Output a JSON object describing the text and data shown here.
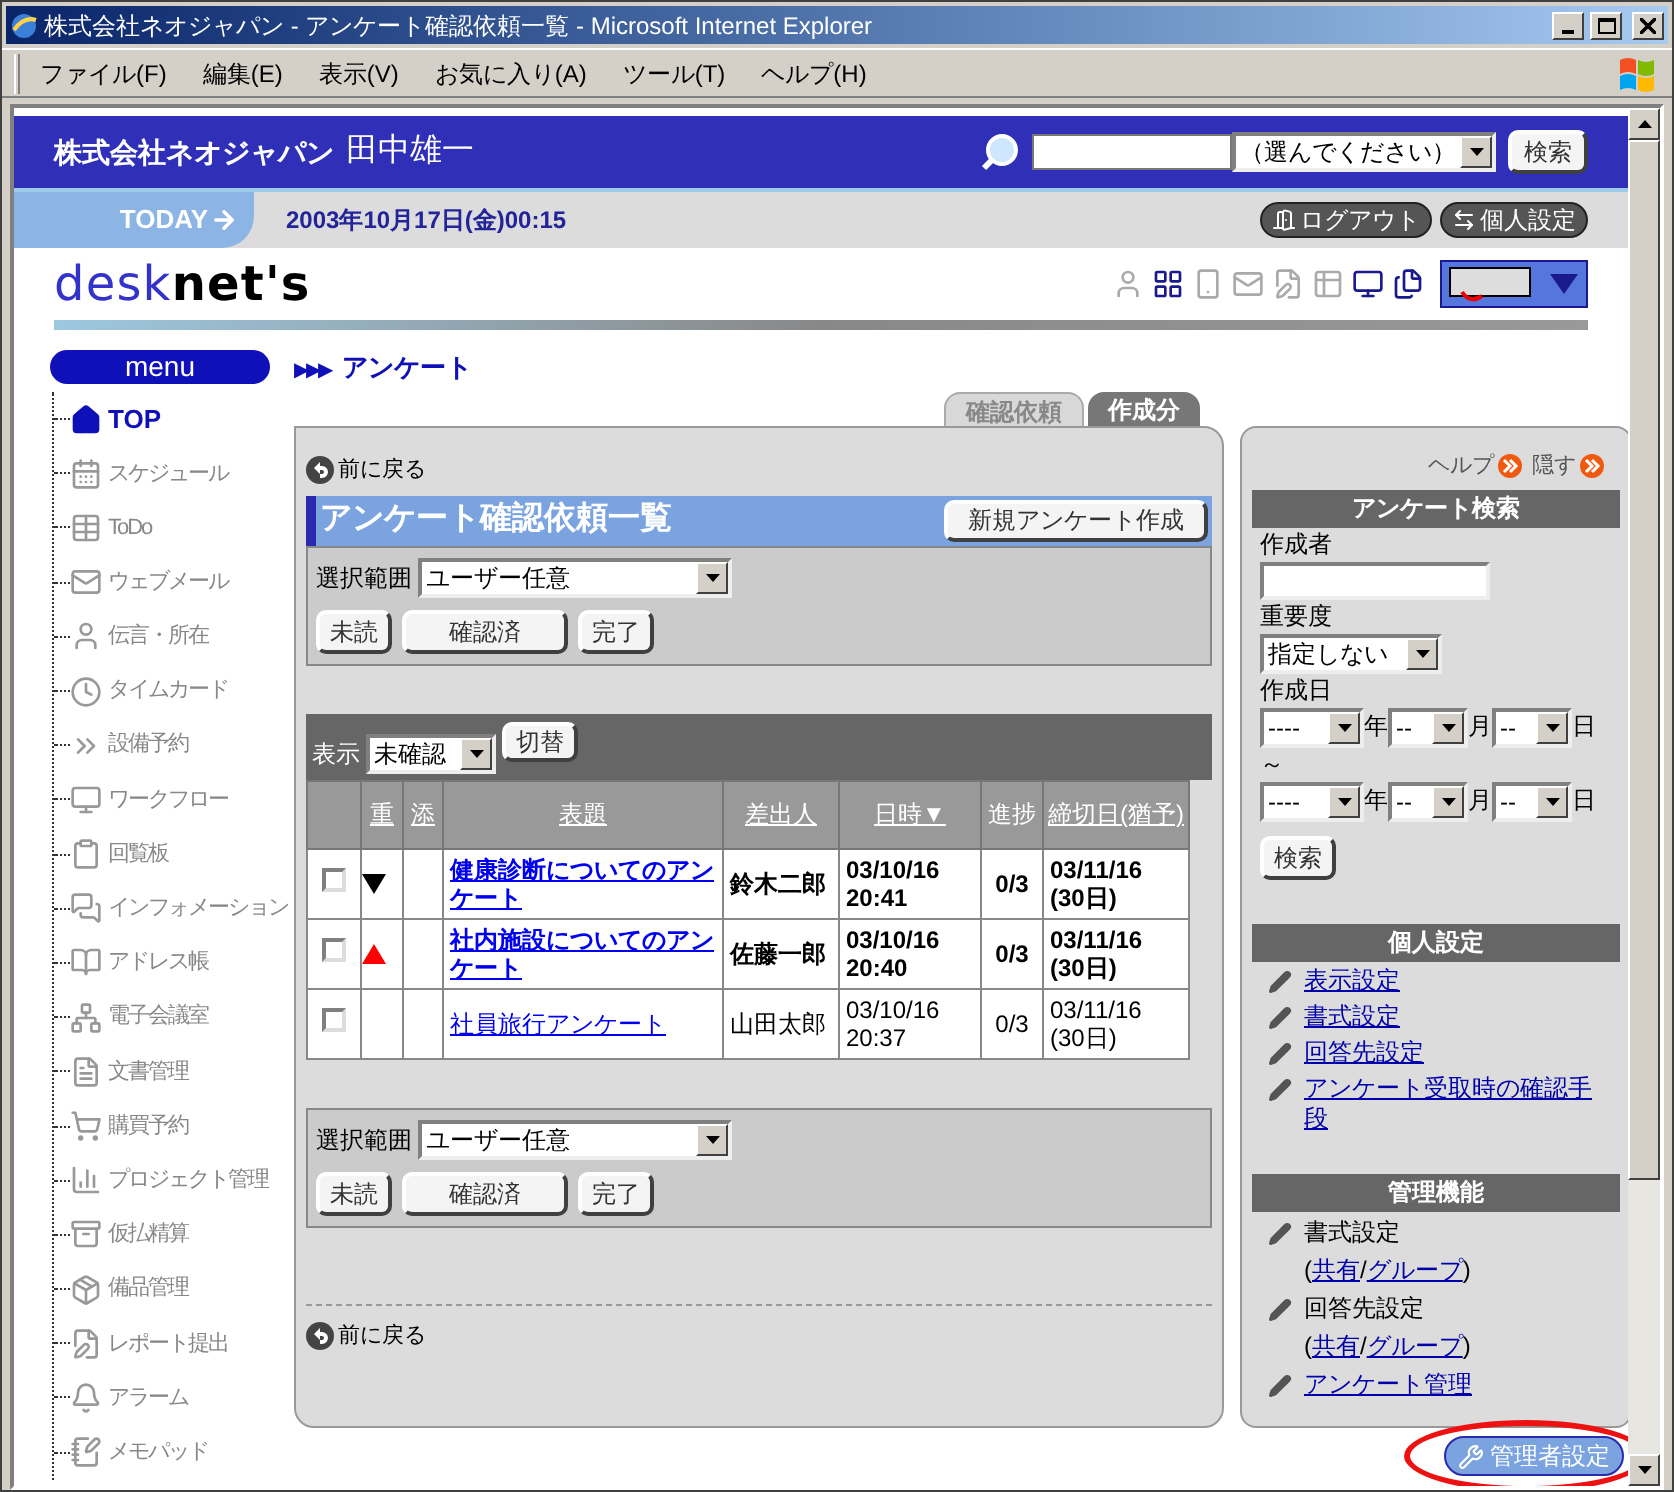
{
  "window": {
    "title": "株式会社ネオジャパン - アンケート確認依頼一覧 - Microsoft Internet Explorer"
  },
  "menu_bar": [
    "ファイル(F)",
    "編集(E)",
    "表示(V)",
    "お気に入り(A)",
    "ツール(T)",
    "ヘルプ(H)"
  ],
  "header": {
    "company": "株式会社ネオジャパン",
    "user": "田中雄一",
    "search_select": "（選んでください）",
    "search_button": "検索"
  },
  "today_bar": {
    "label": "TODAY",
    "date": "2003年10月17日(金)00:15",
    "logout": "ログアウト",
    "personal": "個人設定"
  },
  "logo": "desk**net's**",
  "breadcrumb": {
    "menu": "menu",
    "marker": "▶▶▶",
    "title": "アンケート"
  },
  "sidebar": {
    "items": [
      {
        "label": "TOP",
        "kind": "home"
      },
      {
        "label": "スケジュール",
        "kind": "module"
      },
      {
        "label": "ToDo",
        "kind": "module"
      },
      {
        "label": "ウェブメール",
        "kind": "module"
      },
      {
        "label": "伝言・所在",
        "kind": "module"
      },
      {
        "label": "タイムカード",
        "kind": "module"
      },
      {
        "label": "設備予約",
        "kind": "module"
      },
      {
        "label": "ワークフロー",
        "kind": "module"
      },
      {
        "label": "回覧板",
        "kind": "module"
      },
      {
        "label": "インフォメーション",
        "kind": "module"
      },
      {
        "label": "アドレス帳",
        "kind": "module"
      },
      {
        "label": "電子会議室",
        "kind": "module"
      },
      {
        "label": "文書管理",
        "kind": "module"
      },
      {
        "label": "購買予約",
        "kind": "module"
      },
      {
        "label": "プロジェクト管理",
        "kind": "module"
      },
      {
        "label": "仮払精算",
        "kind": "module"
      },
      {
        "label": "備品管理",
        "kind": "module"
      },
      {
        "label": "レポート提出",
        "kind": "module"
      },
      {
        "label": "アラーム",
        "kind": "module"
      },
      {
        "label": "メモパッド",
        "kind": "module"
      }
    ]
  },
  "tabs": [
    {
      "label": "確認依頼",
      "selected": true
    },
    {
      "label": "作成分",
      "selected": false
    }
  ],
  "main": {
    "back_link": "前に戻る",
    "title": "アンケート確認依頼一覧",
    "new_button": "新規アンケート作成",
    "top_actions": {
      "scope_label": "選択範囲",
      "scope_value": "ユーザー任意",
      "buttons": [
        "未読",
        "確認済",
        "完了"
      ]
    },
    "filter": {
      "label": "表示",
      "value": "未確認",
      "button": "切替"
    },
    "table": {
      "columns": [
        {
          "label": "重",
          "sortable": true
        },
        {
          "label": "添",
          "sortable": true
        },
        {
          "label": "表題",
          "sortable": true
        },
        {
          "label": "差出人",
          "sortable": true
        },
        {
          "label": "日時▼",
          "sortable": true
        },
        {
          "label": "進捗",
          "sortable": false
        },
        {
          "label": "締切日(猶予)",
          "sortable": true
        }
      ],
      "rows": [
        {
          "checked": false,
          "kind": "low",
          "unread": true,
          "title": "健康診断についてのアンケート",
          "sender": "鈴木二郎",
          "datetime": "03/10/16 20:41",
          "progress": "0/3",
          "deadline": "03/11/16 (30日)"
        },
        {
          "checked": false,
          "kind": "high",
          "unread": true,
          "title": "社内施設についてのアンケート",
          "sender": "佐藤一郎",
          "datetime": "03/10/16 20:40",
          "progress": "0/3",
          "deadline": "03/11/16 (30日)"
        },
        {
          "checked": false,
          "kind": "normal",
          "unread": false,
          "title": "社員旅行アンケート",
          "sender": "山田太郎",
          "datetime": "03/10/16 20:37",
          "progress": "0/3",
          "deadline": "03/11/16 (30日)"
        }
      ]
    },
    "bottom_actions": {
      "scope_label": "選択範囲",
      "scope_value": "ユーザー任意",
      "buttons": [
        "未読",
        "確認済",
        "完了"
      ]
    },
    "back_link_bottom": "前に戻る"
  },
  "side_panel": {
    "help": "ヘルプ",
    "hide": "隠す",
    "search": {
      "title": "アンケート検索",
      "author_label": "作成者",
      "importance_label": "重要度",
      "importance_value": "指定しない",
      "date_label": "作成日",
      "dates": [
        {
          "year": "----",
          "year_unit": "年",
          "month": "--",
          "month_unit": "月",
          "day": "--",
          "day_unit": "日"
        },
        {
          "year": "----",
          "year_unit": "年",
          "month": "--",
          "month_unit": "月",
          "day": "--",
          "day_unit": "日"
        }
      ],
      "range_mark": "～",
      "button": "検索"
    },
    "personal": {
      "title": "個人設定",
      "links": [
        "表示設定",
        "書式設定",
        "回答先設定",
        "アンケート受取時の確認手段"
      ]
    },
    "admin": {
      "title": "管理機能",
      "items": [
        {
          "kind": "group",
          "label": "書式設定",
          "prefix": "(",
          "links": [
            "共有",
            "グループ"
          ],
          "separator": "/",
          "suffix": ")"
        },
        {
          "kind": "group",
          "label": "回答先設定",
          "prefix": "(",
          "links": [
            "共有",
            "グループ"
          ],
          "separator": "/",
          "suffix": ")"
        },
        {
          "kind": "link",
          "label": "アンケート管理"
        }
      ]
    }
  },
  "admin_button": "管理者設定"
}
